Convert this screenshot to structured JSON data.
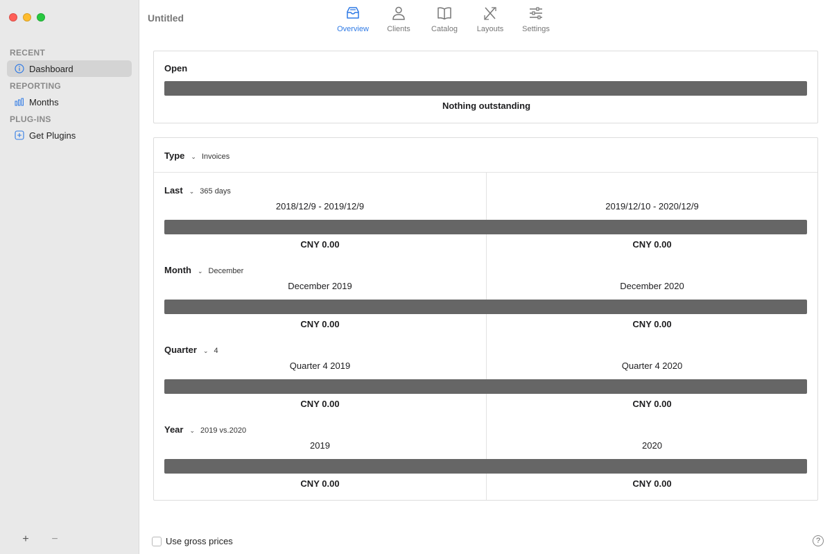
{
  "window": {
    "title": "Untitled"
  },
  "toolbar": {
    "items": [
      {
        "label": "Overview",
        "icon": "tray-icon",
        "active": true
      },
      {
        "label": "Clients",
        "icon": "person-icon"
      },
      {
        "label": "Catalog",
        "icon": "book-icon"
      },
      {
        "label": "Layouts",
        "icon": "layout-tools-icon"
      },
      {
        "label": "Settings",
        "icon": "sliders-icon"
      }
    ]
  },
  "sidebar": {
    "sections": [
      {
        "header": "RECENT",
        "items": [
          {
            "label": "Dashboard",
            "icon": "info-circle-icon",
            "selected": true
          }
        ]
      },
      {
        "header": "REPORTING",
        "items": [
          {
            "label": "Months",
            "icon": "bar-chart-icon"
          }
        ]
      },
      {
        "header": "PLUG-INS",
        "items": [
          {
            "label": "Get Plugins",
            "icon": "plus-square-icon"
          }
        ]
      }
    ],
    "footer": {
      "add": "+",
      "remove": "−"
    }
  },
  "open_card": {
    "label": "Open",
    "status": "Nothing outstanding"
  },
  "type_selector": {
    "label": "Type",
    "value": "Invoices"
  },
  "rows": [
    {
      "label": "Last",
      "value": "365 days",
      "left_period": "2018/12/9 - 2019/12/9",
      "right_period": "2019/12/10 - 2020/12/9",
      "left_amount": "CNY 0.00",
      "right_amount": "CNY 0.00"
    },
    {
      "label": "Month",
      "value": "December",
      "left_period": "December 2019",
      "right_period": "December 2020",
      "left_amount": "CNY 0.00",
      "right_amount": "CNY 0.00"
    },
    {
      "label": "Quarter",
      "value": "4",
      "left_period": "Quarter 4 2019",
      "right_period": "Quarter 4 2020",
      "left_amount": "CNY 0.00",
      "right_amount": "CNY 0.00"
    },
    {
      "label": "Year",
      "value": "2019 vs.2020",
      "left_period": "2019",
      "right_period": "2020",
      "left_amount": "CNY 0.00",
      "right_amount": "CNY 0.00"
    }
  ],
  "footer": {
    "gross_label": "Use gross prices",
    "help": "?"
  },
  "colors": {
    "accent": "#2f7ae5",
    "bar": "#666666",
    "sidebar_bg": "#e9e9e9"
  }
}
